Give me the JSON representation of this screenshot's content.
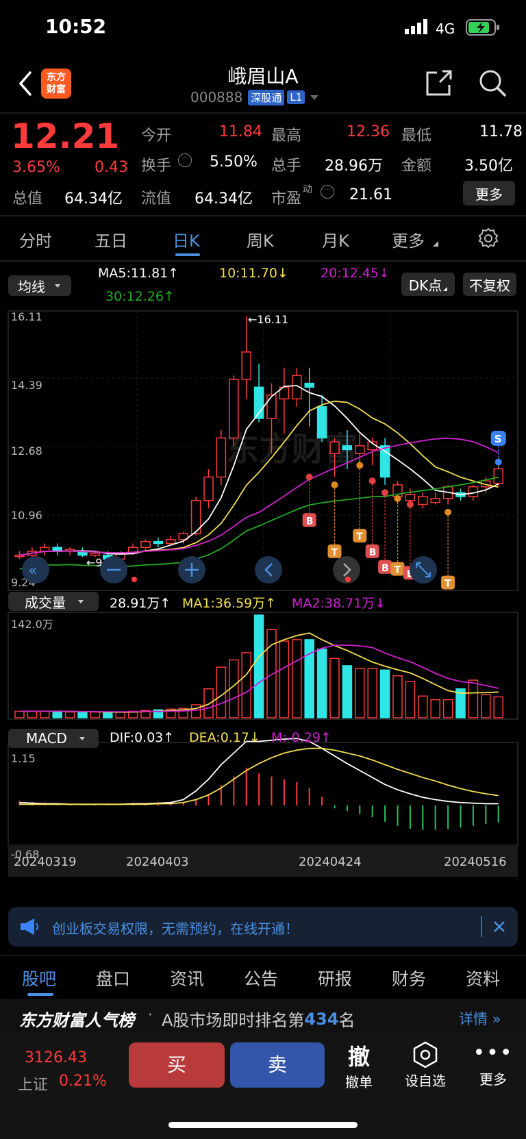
{
  "status": {
    "time": "10:52",
    "network": "4G"
  },
  "header": {
    "title": "峨眉山A",
    "code": "000888",
    "badge_sgt": "深股通",
    "badge_level": "L1",
    "logo_line1": "东方",
    "logo_line2": "财富"
  },
  "quote": {
    "price": "12.21",
    "change_pct": "3.65%",
    "change_abs": "0.43",
    "open_label": "今开",
    "open_value": "11.84",
    "high_label": "最高",
    "high_value": "12.36",
    "low_label": "最低",
    "low_value": "11.78",
    "turnover_label": "换手",
    "turnover_value": "5.50%",
    "volume_label": "总手",
    "volume_value": "28.96万",
    "amount_label": "金额",
    "amount_value": "3.50亿",
    "mktcap_label": "总值",
    "mktcap_value": "64.34亿",
    "float_label": "流值",
    "float_value": "64.34亿",
    "pe_label": "市盈",
    "pe_sup": "动",
    "pe_value": "21.61",
    "more_label": "更多"
  },
  "tabs": {
    "t1": "分时",
    "t2": "五日",
    "t3": "日K",
    "t4": "周K",
    "t5": "月K",
    "t6": "更多"
  },
  "ma_bar": {
    "selector": "均线",
    "ma5": "MA5:11.81↑",
    "ma10": "10:11.70↓",
    "ma20": "20:12.45↓",
    "ma30": "30:12.26↑",
    "dk": "DK点",
    "adjust": "不复权"
  },
  "kline": {
    "y_labels": [
      "16.11",
      "14.39",
      "12.68",
      "10.96",
      "9.24"
    ],
    "high_marker": "←16.11",
    "low_marker": "←9.85",
    "s_marker": "S",
    "watermark": "东方财富"
  },
  "volume_bar": {
    "selector": "成交量",
    "vol": "28.91万↑",
    "ma1": "MA1:36.59万↑",
    "ma2": "MA2:38.71万↓",
    "y_label": "142.0万"
  },
  "macd_bar": {
    "selector": "MACD",
    "dif": "DIF:0.03↑",
    "dea": "DEA:0.17↓",
    "m": "M:-0.29↑",
    "y_top": "1.15",
    "y_bottom": "-0.68"
  },
  "dates": [
    "20240319",
    "20240403",
    "20240424",
    "20240516"
  ],
  "banner": {
    "text": "创业板交易权限，无需预约，在线开通！"
  },
  "bottom_tabs": {
    "b1": "股吧",
    "b2": "盘口",
    "b3": "资讯",
    "b4": "公告",
    "b5": "研报",
    "b6": "财务",
    "b7": "资料"
  },
  "rank": {
    "brand": "东方财富人气榜",
    "dot": "·",
    "text_pre": "A股市场即时排名第",
    "rank_num": "434",
    "text_post": "名",
    "detail": "详情"
  },
  "footer": {
    "index_value": "3126.43",
    "index_name": "上证",
    "index_pct": "0.21%",
    "buy": "买",
    "sell": "卖",
    "cancel_glyph": "撤",
    "cancel": "撤单",
    "watch": "设自选",
    "more": "更多"
  },
  "colors": {
    "up": "#ff3b3b",
    "down": "#2ee6e6",
    "ma5": "#ffffff",
    "ma10": "#f5e050",
    "ma20": "#d020d0",
    "ma30": "#22aa22",
    "brand": "#ff5a1f",
    "accent": "#3b82f6"
  }
}
